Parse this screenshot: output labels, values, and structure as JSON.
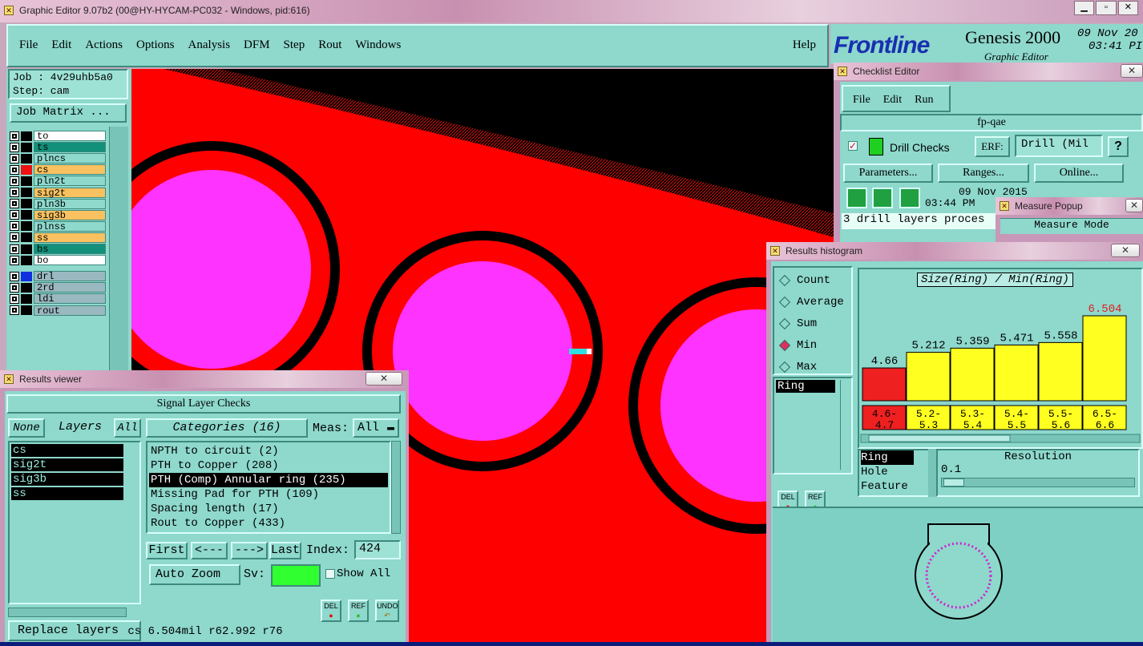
{
  "app": {
    "title": "Graphic Editor 9.07b2 (00@HY-HYCAM-PC032 - Windows, pid:616)"
  },
  "menu": {
    "file": "File",
    "edit": "Edit",
    "actions": "Actions",
    "options": "Options",
    "analysis": "Analysis",
    "dfm": "DFM",
    "step": "Step",
    "rout": "Rout",
    "windows": "Windows",
    "help": "Help"
  },
  "brand": {
    "logo": "Frontline",
    "product": "Genesis 2000",
    "date": "09 Nov 20",
    "time": "03:41 PI",
    "subtitle": "Graphic Editor"
  },
  "job": {
    "job": "Job : 4v29uhb5a0",
    "step": "Step: cam",
    "matrix": "Job Matrix ..."
  },
  "layers": [
    {
      "name": "to",
      "color": "#ffffff",
      "swatch": "#000"
    },
    {
      "name": "ts",
      "color": "#12907a",
      "swatch": "#000"
    },
    {
      "name": "plncs",
      "color": "#8ed8cc",
      "swatch": "#000"
    },
    {
      "name": "cs",
      "color": "#f9c160",
      "swatch": "#ee1111"
    },
    {
      "name": "pln2t",
      "color": "#8ed8cc",
      "swatch": "#000"
    },
    {
      "name": "sig2t",
      "color": "#f9c160",
      "swatch": "#000"
    },
    {
      "name": "pln3b",
      "color": "#8ed8cc",
      "swatch": "#000"
    },
    {
      "name": "sig3b",
      "color": "#f9c160",
      "swatch": "#000"
    },
    {
      "name": "plnss",
      "color": "#8ed8cc",
      "swatch": "#000"
    },
    {
      "name": "ss",
      "color": "#f9c160",
      "swatch": "#000"
    },
    {
      "name": "bs",
      "color": "#12907a",
      "swatch": "#000"
    },
    {
      "name": "bo",
      "color": "#ffffff",
      "swatch": "#000"
    },
    {
      "name": "drl",
      "color": "#9ab8c0",
      "swatch": "#1030e0"
    },
    {
      "name": "2rd",
      "color": "#9ab8c0",
      "swatch": "#000"
    },
    {
      "name": "ldi",
      "color": "#9ab8c0",
      "swatch": "#000"
    },
    {
      "name": "rout",
      "color": "#9ab8c0",
      "swatch": "#000"
    }
  ],
  "results_viewer": {
    "title": "Results viewer",
    "header": "Signal Layer Checks",
    "none": "None",
    "layers_label": "Layers",
    "all": "All",
    "categories": "Categories (16)",
    "meas_label": "Meas:",
    "meas_value": "All",
    "layer_list": [
      "cs",
      "sig2t",
      "sig3b",
      "ss"
    ],
    "category_list": [
      "NPTH to circuit (2)",
      "PTH to Copper (208)",
      "PTH (Comp) Annular ring (235)",
      "Missing Pad for PTH (109)",
      "Spacing length (17)",
      "Rout to Copper (433)"
    ],
    "selected_category": 2,
    "first": "First",
    "prev": "<---",
    "next": "--->",
    "last": "Last",
    "index_label": "Index:",
    "index_value": "424",
    "auto_zoom": "Auto Zoom",
    "sv": "Sv:",
    "show_all": "Show All",
    "replace": "Replace layers",
    "del": "DEL",
    "ref": "REF",
    "undo": "UNDO",
    "status": "cs 6.504mil  r62.992  r76"
  },
  "checklist": {
    "title": "Checklist Editor",
    "file": "File",
    "edit": "Edit",
    "run": "Run",
    "name": "fp-qae",
    "drill_checks": "Drill Checks",
    "erf": "ERF:",
    "erf_value": "Drill (Mil",
    "help": "?",
    "parameters": "Parameters...",
    "ranges": "Ranges...",
    "online": "Online...",
    "date": "09 Nov 2015",
    "time": "03:44 PM",
    "message": "3 drill layers proces"
  },
  "measure": {
    "title": "Measure Popup",
    "mode": "Measure Mode"
  },
  "histogram": {
    "title": "Results histogram",
    "options": [
      "Count",
      "Average",
      "Sum",
      "Min",
      "Max"
    ],
    "selected": "Min",
    "list": [
      "Ring"
    ],
    "del": "DEL",
    "ref": "REF",
    "chart_title": "Size(Ring) / Min(Ring)",
    "types": [
      "Ring",
      "Hole",
      "Feature"
    ],
    "resolution_label": "Resolution",
    "resolution_value": "0.1"
  },
  "chart_data": {
    "type": "bar",
    "title": "Size(Ring) / Min(Ring)",
    "categories": [
      "4.6-4.7",
      "5.2-5.3",
      "5.3-5.4",
      "5.4-5.5",
      "5.5-5.6",
      "6.5-6.6"
    ],
    "values": [
      4.66,
      5.212,
      5.359,
      5.471,
      5.558,
      6.504
    ],
    "value_labels": [
      "4.66",
      "5.212",
      "5.359",
      "5.471",
      "5.558",
      "6.504"
    ],
    "bar_colors": [
      "#ee2020",
      "#ffff20",
      "#ffff20",
      "#ffff20",
      "#ffff20",
      "#ffff20"
    ],
    "cat_top": [
      "4.6-",
      "5.2-",
      "5.3-",
      "5.4-",
      "5.5-",
      "6.5-"
    ],
    "cat_bottom": [
      "4.7",
      "5.3",
      "5.4",
      "5.5",
      "5.6",
      "6.6"
    ]
  }
}
